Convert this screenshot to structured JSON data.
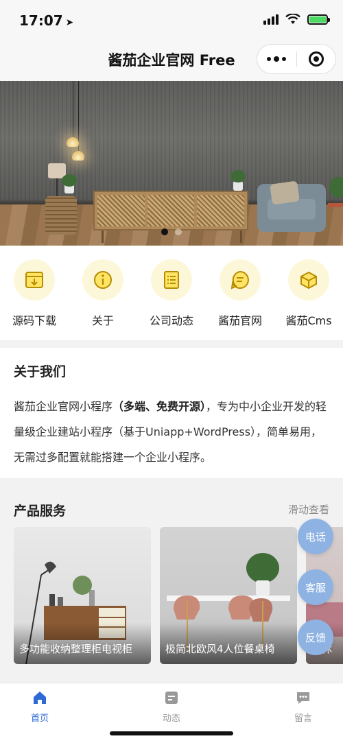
{
  "status_bar": {
    "time": "17:07"
  },
  "nav_bar": {
    "title": "酱茄企业官网 Free"
  },
  "banner": {
    "total_slides": 2,
    "active_slide": 1
  },
  "icon_nav": [
    {
      "label": "源码下载",
      "icon": "download-box-icon"
    },
    {
      "label": "关于",
      "icon": "info-icon"
    },
    {
      "label": "公司动态",
      "icon": "list-document-icon"
    },
    {
      "label": "酱茄官网",
      "icon": "chat-bubble-icon"
    },
    {
      "label": "酱茄Cms",
      "icon": "cube-icon"
    }
  ],
  "about": {
    "title": "关于我们",
    "text_part1": "酱茄企业官网小程序",
    "text_bold": "（多端、免费开源）",
    "text_part2": "，专为中小企业开发的轻量级企业建站小程序（基于Uniapp+WordPress），简单易用，无需过多配置就能搭建一个企业小程序。"
  },
  "products": {
    "title": "产品服务",
    "more_label": "滑动查看",
    "items": [
      {
        "name": "多功能收纳整理柜电视柜"
      },
      {
        "name": "极简北欧风4人位餐桌椅"
      },
      {
        "name": "奢休"
      }
    ]
  },
  "float_buttons": {
    "phone": "电话",
    "service": "客服",
    "feedback": "反馈"
  },
  "tab_bar": [
    {
      "label": "首页",
      "icon": "home-icon",
      "active": true
    },
    {
      "label": "动态",
      "icon": "document-icon",
      "active": false
    },
    {
      "label": "留言",
      "icon": "message-icon",
      "active": false
    }
  ],
  "colors": {
    "accent": "#2d6ad6",
    "icon_bg": "#fdf7d9",
    "icon_stroke": "#d9a400",
    "float_button": "#8eb3e3"
  }
}
